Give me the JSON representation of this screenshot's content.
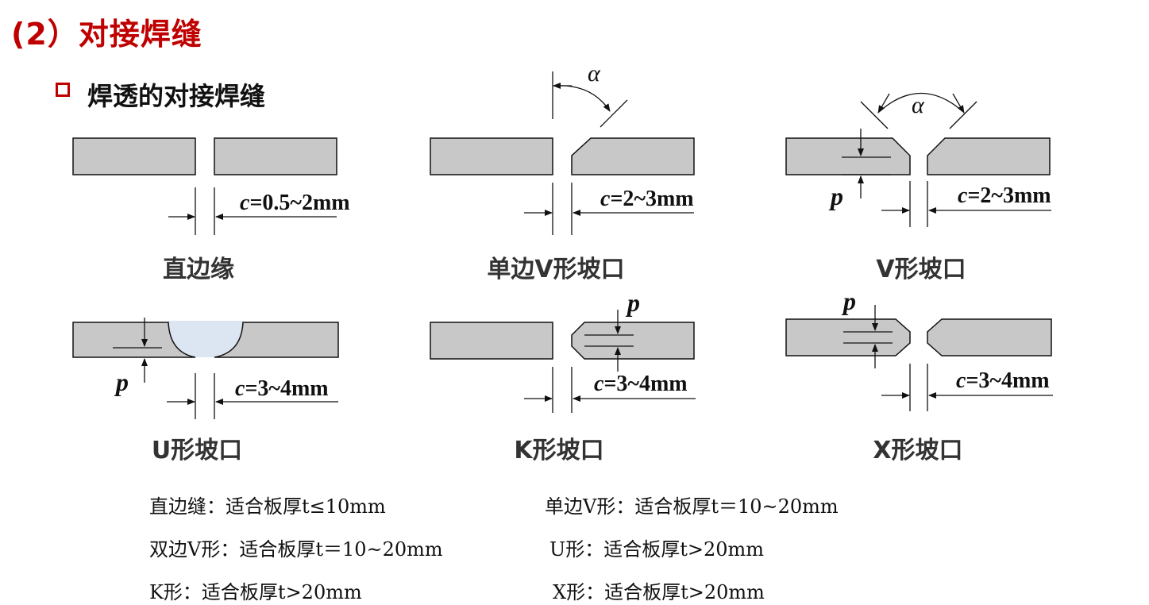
{
  "header": {
    "title": "(2）对接焊缝",
    "subtitle": "焊透的对接焊缝"
  },
  "diagrams": {
    "straight": {
      "caption": "直边缘",
      "c_label": "c",
      "c_value": "=0.5~2mm"
    },
    "single_v": {
      "caption": "单边V形坡口",
      "c_label": "c",
      "c_value": "=2~3mm",
      "angle_label": "α"
    },
    "v": {
      "caption": "V形坡口",
      "c_label": "c",
      "c_value": "=2~3mm",
      "angle_label": "α",
      "p_label": "p"
    },
    "u": {
      "caption": "U形坡口",
      "c_label": "c",
      "c_value": "=3~4mm",
      "p_label": "p"
    },
    "k": {
      "caption": "K形坡口",
      "c_label": "c",
      "c_value": "=3~4mm",
      "p_label": "p"
    },
    "x": {
      "caption": "X形坡口",
      "c_label": "c",
      "c_value": "=3~4mm",
      "p_label": "p"
    }
  },
  "notes": [
    "直边缝：适合板厚t≤10mm",
    "单边V形：适合板厚t＝10~20mm",
    "双边V形：适合板厚t＝10~20mm",
    "U形：适合板厚t>20mm",
    "K形：适合板厚t>20mm",
    "X形：适合板厚t>20mm"
  ],
  "colors": {
    "title": "#c00000",
    "plate": "#c8c8c8",
    "u_groove": "#dce6f2"
  }
}
